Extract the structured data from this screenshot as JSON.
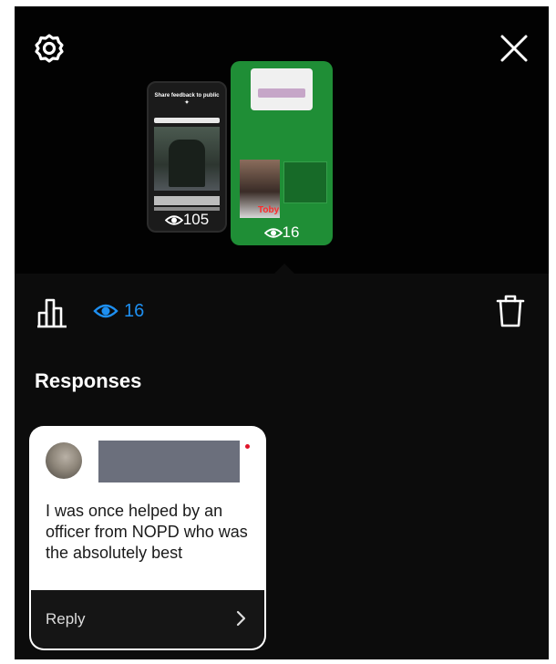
{
  "story_tray": {
    "stories": [
      {
        "title_text": "Share feedback to public ✦",
        "views": "105"
      },
      {
        "highlight_text": "Toby",
        "views": "16"
      }
    ]
  },
  "toolbar": {
    "viewer_count": "16",
    "accent_color": "#1e8ff0"
  },
  "responses": {
    "heading": "Responses",
    "items": [
      {
        "message": "I was once helped by an officer from NOPD who was the absolutely best",
        "reply_label": "Reply"
      }
    ]
  },
  "icons": [
    "settings-icon",
    "close-icon",
    "insights-icon",
    "eye-icon",
    "trash-icon",
    "chevron-right-icon"
  ]
}
